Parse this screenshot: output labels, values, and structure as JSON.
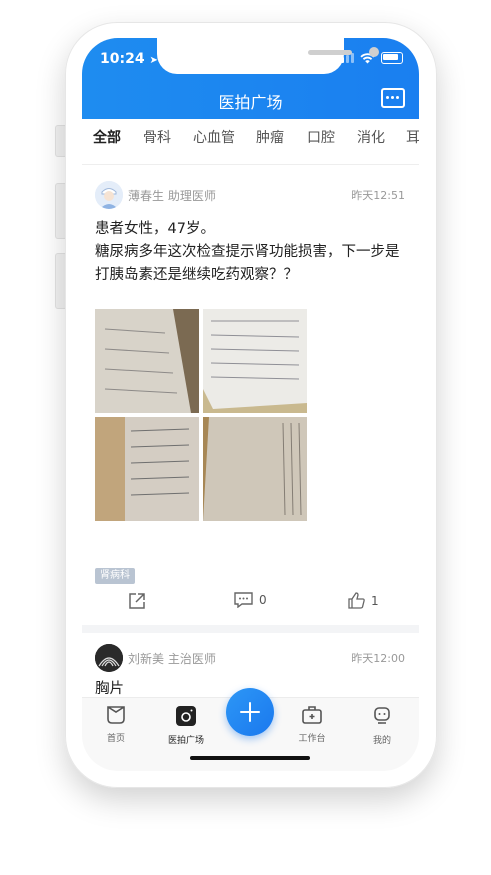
{
  "status_bar": {
    "time": "10:24"
  },
  "header": {
    "title": "医拍广场"
  },
  "tabs": [
    {
      "label": "全部",
      "active": true
    },
    {
      "label": "骨科",
      "active": false
    },
    {
      "label": "心血管",
      "active": false
    },
    {
      "label": "肿瘤",
      "active": false
    },
    {
      "label": "口腔",
      "active": false
    },
    {
      "label": "消化",
      "active": false
    },
    {
      "label": "耳",
      "active": false
    }
  ],
  "posts": [
    {
      "author": "薄春生 助理医师",
      "time": "昨天12:51",
      "text_line1": "患者女性，47岁。",
      "text_line2": "糖尿病多年这次检查提示肾功能损害，下一步是",
      "text_line3": "打胰岛素还是继续吃药观察？？",
      "tag": "肾病科",
      "comments": "0",
      "likes": "1"
    },
    {
      "author": "刘新美 主治医师",
      "time": "昨天12:00",
      "text": "胸片"
    }
  ],
  "tabbar": {
    "home": "首页",
    "plaza": "医拍广场",
    "workbench": "工作台",
    "mine": "我的"
  },
  "colors": {
    "brand_blue": "#1a82f0",
    "tag_gray": "#b9c4d2"
  },
  "icons": [
    "location-arrow-icon",
    "signal-icon",
    "wifi-icon",
    "battery-icon",
    "message-icon",
    "share-icon",
    "comment-icon",
    "like-icon",
    "home-icon",
    "camera-icon",
    "plus-icon",
    "briefcase-icon",
    "robot-icon"
  ]
}
